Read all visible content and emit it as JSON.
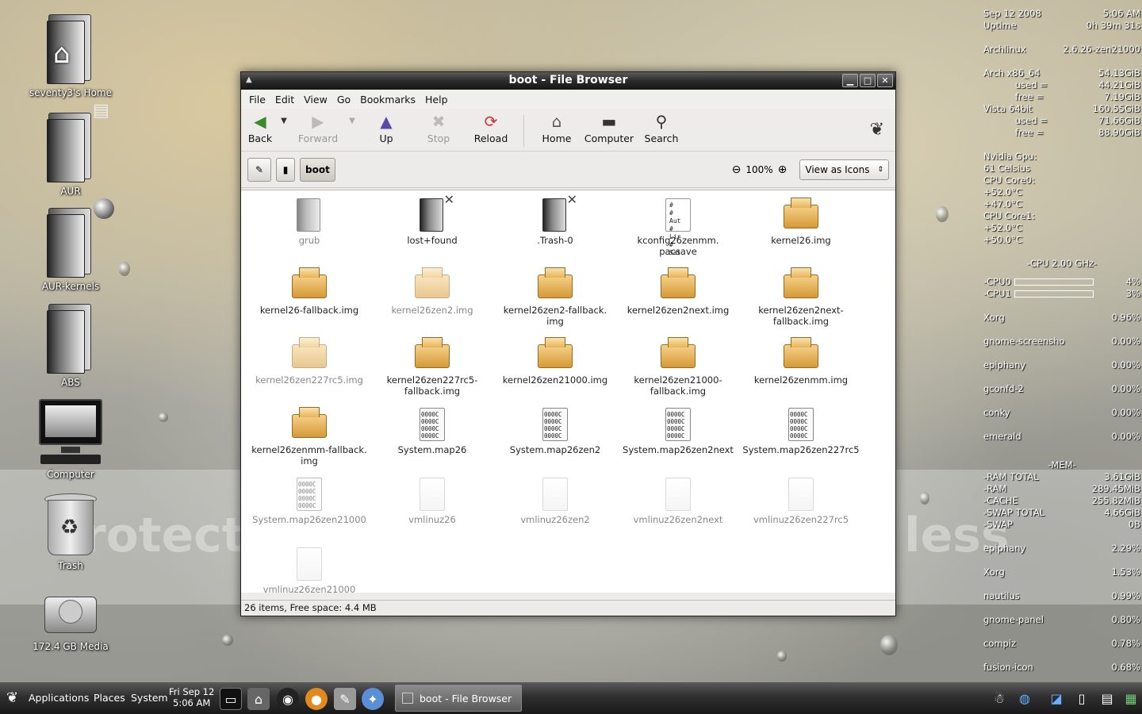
{
  "desktop": {
    "icons": [
      {
        "label": "seventy3's Home",
        "icon": "home-folder-icon"
      },
      {
        "label": "AUR",
        "icon": "folder-icon"
      },
      {
        "label": "AUR-kernels",
        "icon": "folder-icon"
      },
      {
        "label": "ABS",
        "icon": "folder-icon"
      },
      {
        "label": "Computer",
        "icon": "computer-icon"
      },
      {
        "label": "Trash",
        "icon": "trash-icon"
      },
      {
        "label": "172.4 GB Media",
        "icon": "drive-icon"
      }
    ],
    "watermark_left": "Protect",
    "watermark_right": "less"
  },
  "conky": {
    "date": "Sep 12 2008",
    "time": "5:06 AM",
    "uptime_label": "Uptime",
    "uptime": "0h 39m 31s",
    "os": "Archlinux",
    "kernel": "2.6.26-zen21000",
    "arch_label": "Arch x86_64",
    "arch_total": "54.13GiB",
    "arch_used_label": "used =",
    "arch_used": "44.21GiB",
    "arch_free_label": "free =",
    "arch_free": "7.19GiB",
    "vista_label": "Vista 64bit",
    "vista_total": "160.55GiB",
    "vista_used_label": "used =",
    "vista_used": "71.66GiB",
    "vista_free_label": "free =",
    "vista_free": "88.90GiB",
    "gpu_label": "Nvidia Gpu:",
    "gpu_temp": "61 Celsius",
    "core0_label": "CPU Core0:",
    "core0_t1": "+52.0°C",
    "core0_t2": "+47.0°C",
    "core1_label": "CPU Core1:",
    "core1_t1": "+52.0°C",
    "core1_t2": "+50.0°C",
    "cpu_header": "-CPU 2.00 GHz-",
    "cpu0_label": "-CPU0",
    "cpu0": "4%",
    "cpu1_label": "-CPU1",
    "cpu1": "3%",
    "procs": [
      {
        "name": "Xorg",
        "val": "0.96%"
      },
      {
        "name": "gnome-screensho",
        "val": "0.00%"
      },
      {
        "name": "epiphany",
        "val": "0.00%"
      },
      {
        "name": "gconfd-2",
        "val": "0.00%"
      },
      {
        "name": "conky",
        "val": "0.00%"
      },
      {
        "name": "emerald",
        "val": "0.00%"
      }
    ],
    "mem_header": "-MEM-",
    "mem": [
      {
        "name": "-RAM TOTAL",
        "val": "3.61GiB"
      },
      {
        "name": "-RAM",
        "val": "289.45MiB"
      },
      {
        "name": "-CACHE",
        "val": "255.82MiB"
      },
      {
        "name": "-SWAP TOTAL",
        "val": "4.66GiB"
      },
      {
        "name": "-SWAP",
        "val": "0B"
      }
    ],
    "memprocs": [
      {
        "name": "epiphany",
        "val": "2.29%"
      },
      {
        "name": "Xorg",
        "val": "1.53%"
      },
      {
        "name": "nautilus",
        "val": "0.99%"
      },
      {
        "name": "gnome-panel",
        "val": "0.80%"
      },
      {
        "name": "compiz",
        "val": "0.78%"
      },
      {
        "name": "fusion-icon",
        "val": "0.68%"
      }
    ]
  },
  "window": {
    "title": "boot - File Browser",
    "menu": [
      "File",
      "Edit",
      "View",
      "Go",
      "Bookmarks",
      "Help"
    ],
    "toolbar": {
      "back": "Back",
      "forward": "Forward",
      "up": "Up",
      "stop": "Stop",
      "reload": "Reload",
      "home": "Home",
      "computer": "Computer",
      "search": "Search"
    },
    "location": {
      "current": "boot",
      "zoom": "100%",
      "view": "View as Icons"
    },
    "files": [
      {
        "name": "grub",
        "type": "folder",
        "dim": true
      },
      {
        "name": "lost+found",
        "type": "folder-x"
      },
      {
        "name": ".Trash-0",
        "type": "folder-x"
      },
      {
        "name": "kconfig26zenmm.\npacsave",
        "type": "text"
      },
      {
        "name": "kernel26.img",
        "type": "pkg"
      },
      {
        "name": "kernel26-fallback.img",
        "type": "pkg"
      },
      {
        "name": "kernel26zen2.img",
        "type": "pkg",
        "dim": true
      },
      {
        "name": "kernel26zen2-fallback.\nimg",
        "type": "pkg"
      },
      {
        "name": "kernel26zen2next.img",
        "type": "pkg"
      },
      {
        "name": "kernel26zen2next-\nfallback.img",
        "type": "pkg"
      },
      {
        "name": "kernel26zen227rc5.img",
        "type": "pkg",
        "dim": true
      },
      {
        "name": "kernel26zen227rc5-\nfallback.img",
        "type": "pkg"
      },
      {
        "name": "kernel26zen21000.img",
        "type": "pkg"
      },
      {
        "name": "kernel26zen21000-\nfallback.img",
        "type": "pkg"
      },
      {
        "name": "kernel26zenmm.img",
        "type": "pkg"
      },
      {
        "name": "kernel26zenmm-fallback.\nimg",
        "type": "pkg"
      },
      {
        "name": "System.map26",
        "type": "bin"
      },
      {
        "name": "System.map26zen2",
        "type": "bin"
      },
      {
        "name": "System.map26zen2next",
        "type": "bin"
      },
      {
        "name": "System.map26zen227rc5",
        "type": "bin"
      },
      {
        "name": "System.map26zen21000",
        "type": "bin",
        "dim": true
      },
      {
        "name": "vmlinuz26",
        "type": "blank",
        "dim": true
      },
      {
        "name": "vmlinuz26zen2",
        "type": "blank",
        "dim": true
      },
      {
        "name": "vmlinuz26zen2next",
        "type": "blank",
        "dim": true
      },
      {
        "name": "vmlinuz26zen227rc5",
        "type": "blank",
        "dim": true
      },
      {
        "name": "vmlinuz26zen21000",
        "type": "blank",
        "dim": true
      }
    ],
    "status": "26 items, Free space: 4.4 MB"
  },
  "taskbar": {
    "applications": "Applications",
    "places": "Places",
    "system": "System",
    "clock_date": "Fri Sep 12",
    "clock_time": "5:06 AM",
    "task": "boot - File Browser"
  }
}
